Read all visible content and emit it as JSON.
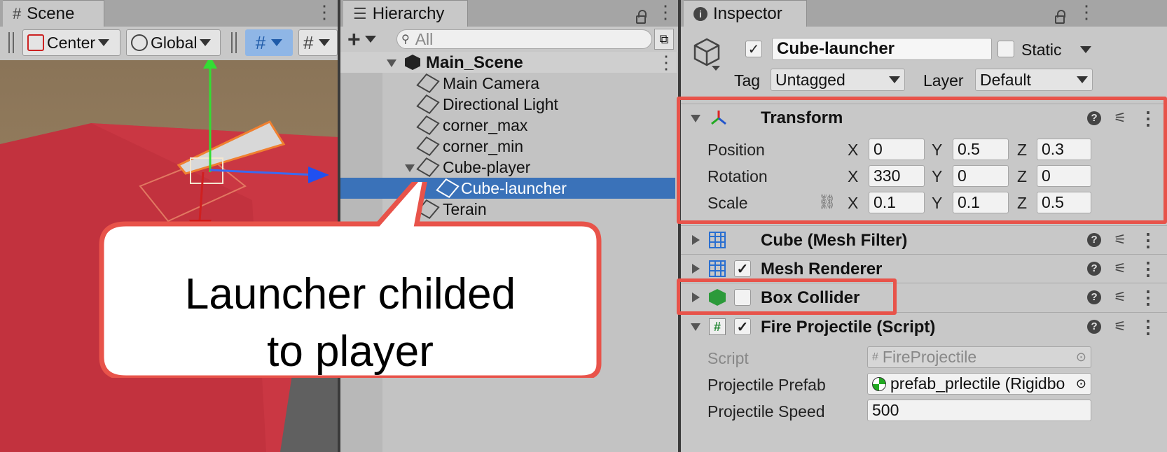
{
  "scene": {
    "tab": "Scene",
    "pivot": "Center",
    "space": "Global"
  },
  "hierarchy": {
    "tab": "Hierarchy",
    "search_placeholder": "All",
    "scene_root": "Main_Scene",
    "items": [
      {
        "label": "Main Camera"
      },
      {
        "label": "Directional Light"
      },
      {
        "label": "corner_max"
      },
      {
        "label": "corner_min"
      },
      {
        "label": "Cube-player"
      },
      {
        "label": "Cube-launcher"
      },
      {
        "label": "Terain"
      }
    ]
  },
  "inspector": {
    "tab": "Inspector",
    "object_name": "Cube-launcher",
    "static_label": "Static",
    "tag_label": "Tag",
    "tag_value": "Untagged",
    "layer_label": "Layer",
    "layer_value": "Default",
    "transform": {
      "title": "Transform",
      "position_label": "Position",
      "rotation_label": "Rotation",
      "scale_label": "Scale",
      "position": {
        "x": "0",
        "y": "0.5",
        "z": "0.3"
      },
      "rotation": {
        "x": "330",
        "y": "0",
        "z": "0"
      },
      "scale": {
        "x": "0.1",
        "y": "0.1",
        "z": "0.5"
      }
    },
    "mesh_filter": "Cube (Mesh Filter)",
    "mesh_renderer": "Mesh Renderer",
    "box_collider": "Box Collider",
    "fire_script": "Fire Projectile (Script)",
    "script_label": "Script",
    "script_value": "FireProjectile",
    "prefab_label": "Projectile Prefab",
    "prefab_value": "prefab_prlectile (Rigidbo",
    "speed_label": "Projectile Speed",
    "speed_value": "500",
    "axis_x": "X",
    "axis_y": "Y",
    "axis_z": "Z"
  },
  "callout": {
    "line1": "Launcher childed",
    "line2": "to player"
  },
  "colors": {
    "highlight": "#e8534a",
    "selection": "#3a72b9"
  }
}
